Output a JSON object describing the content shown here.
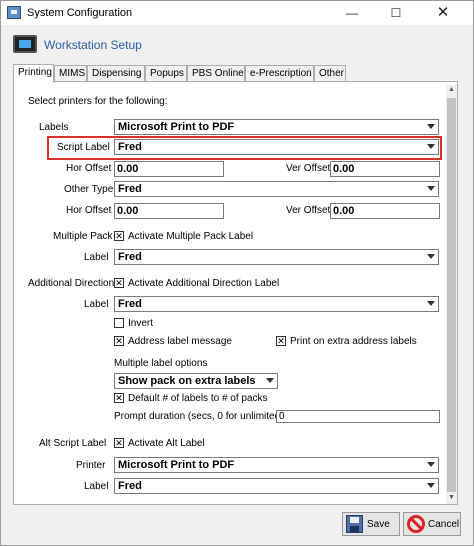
{
  "window": {
    "title": "System Configuration",
    "minimize": "—",
    "maximize": "☐",
    "close": "✕"
  },
  "header": {
    "title": "Workstation Setup"
  },
  "tabs": [
    "Printing",
    "MIMS",
    "Dispensing",
    "Popups",
    "PBS Online",
    "e-Prescription",
    "Other"
  ],
  "printing": {
    "intro": "Select printers for the following:",
    "labels_label": "Labels",
    "labels_value": "Microsoft Print to PDF",
    "script_label_label": "Script Label",
    "script_label_value": "Fred",
    "hor_offset_label": "Hor Offset",
    "ver_offset_label": "Ver Offset",
    "hor_offset_1": "0.00",
    "ver_offset_1": "0.00",
    "other_type_label": "Other Type",
    "other_type_value": "Fred",
    "hor_offset_2": "0.00",
    "ver_offset_2": "0.00",
    "multiple_pack_label": "Multiple Pack",
    "multiple_pack_check": "Activate Multiple Pack Label",
    "multiple_pack_check_checked": true,
    "label_label": "Label",
    "multiple_pack_label_value": "Fred",
    "additional_direction_label": "Additional Direction",
    "additional_direction_check": "Activate Additional Direction Label",
    "additional_direction_check_checked": true,
    "additional_direction_label_value": "Fred",
    "invert_label": "Invert",
    "invert_checked": false,
    "address_label_message": "Address label message",
    "address_label_message_checked": true,
    "print_on_extra": "Print on extra address labels",
    "print_on_extra_checked": true,
    "multiple_label_options": "Multiple label options",
    "show_pack_value": "Show pack on extra labels",
    "default_labels": "Default # of labels to # of packs",
    "default_labels_checked": true,
    "prompt_duration_label": "Prompt duration (secs, 0 for unlimited)",
    "prompt_duration_value": "0",
    "alt_script_label": "Alt Script Label",
    "alt_label_check": "Activate Alt Label",
    "alt_label_check_checked": true,
    "printer_label": "Printer",
    "alt_printer_value": "Microsoft Print to PDF",
    "alt_label_value": "Fred"
  },
  "buttons": {
    "save": "Save",
    "cancel": "Cancel"
  },
  "colors": {
    "highlight": "#d9302b",
    "header": "#2a5ea8"
  }
}
